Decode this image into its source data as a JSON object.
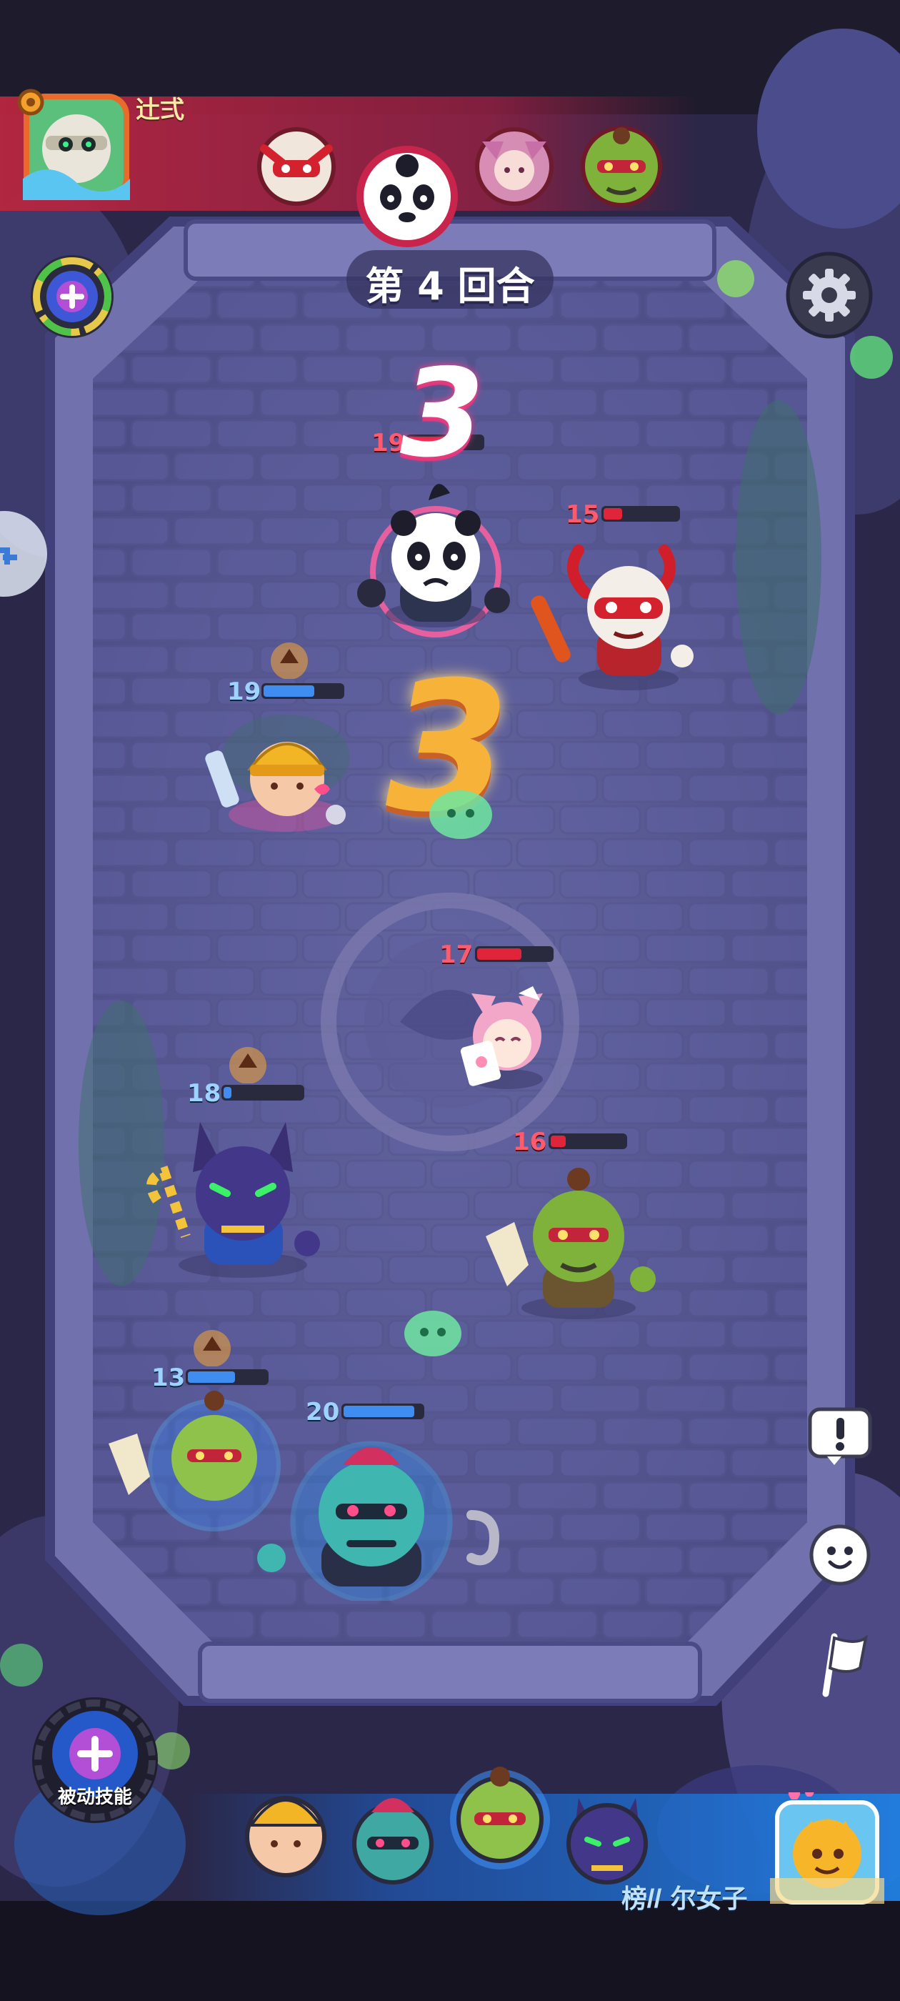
{
  "top_bar": {
    "player_name": "辻弍",
    "turn_order": [
      {
        "name": "masked-monkey",
        "active": false
      },
      {
        "name": "panda",
        "active": true
      },
      {
        "name": "fox-girl",
        "active": false
      },
      {
        "name": "green-orc",
        "active": false
      }
    ]
  },
  "round_label": "第 4 回合",
  "countdown_small": "3",
  "countdown_big": "3",
  "units": [
    {
      "id": "panda",
      "team": "enemy",
      "level": "19",
      "hp": 0.55
    },
    {
      "id": "monkey-king",
      "team": "enemy",
      "level": "15",
      "hp": 0.25
    },
    {
      "id": "miner-girl",
      "team": "ally",
      "level": "19",
      "hp": 0.65
    },
    {
      "id": "fox-girl",
      "team": "enemy",
      "level": "17",
      "hp": 0.6
    },
    {
      "id": "anubis",
      "team": "ally",
      "level": "18",
      "hp": 0.1
    },
    {
      "id": "orc-enemy",
      "team": "enemy",
      "level": "16",
      "hp": 0.2
    },
    {
      "id": "orc-ally",
      "team": "ally",
      "level": "13",
      "hp": 0.6
    },
    {
      "id": "troll-hook",
      "team": "ally",
      "level": "20",
      "hp": 0.9
    }
  ],
  "buttons": {
    "passive_skill_label": "被动技能"
  },
  "bottom_bar": {
    "opponent_name": "榜𝐼𝐼 尔女子",
    "bench": [
      "miner-girl",
      "troll-hook",
      "orc-ally",
      "anubis"
    ]
  },
  "colors": {
    "enemy_hp": "#e0243a",
    "ally_hp": "#3f8df0",
    "arena_floor": "#5a5b93",
    "accent_orange": "#f5a531"
  }
}
